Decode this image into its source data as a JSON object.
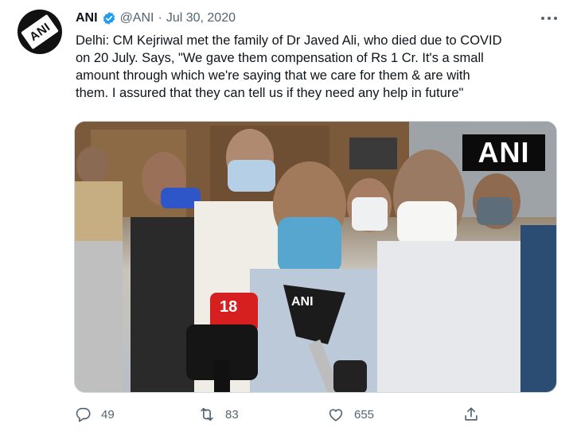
{
  "tweet": {
    "name": "ANI",
    "handle": "@ANI",
    "separator": "·",
    "date": "Jul 30, 2020",
    "avatar_text": "ANI",
    "text": "Delhi: CM Kejriwal met the family of Dr Javed Ali, who died due to COVID\non 20 July. Says, \"We gave them compensation of Rs 1 Cr. It's a small\namount through which we're saying that we care for them & are with\nthem. I assured that they can tell us if they need any help in future\"",
    "media": {
      "logo": "ANI",
      "mic_ani": "ANI",
      "mic_channel": "18"
    },
    "actions": {
      "replies": "49",
      "retweets": "83",
      "likes": "655"
    }
  },
  "colors": {
    "text": "#0f1419",
    "secondary": "#536471",
    "verified": "#1d9bf0",
    "border": "#cfd9de"
  },
  "icons": [
    "verified-badge-icon",
    "more-icon",
    "reply-icon",
    "retweet-icon",
    "like-icon",
    "share-icon"
  ]
}
